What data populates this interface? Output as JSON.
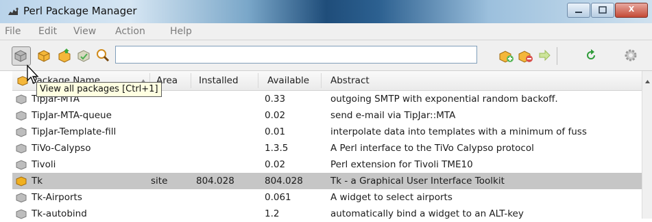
{
  "window": {
    "title": "Perl Package Manager",
    "controls": [
      "minimize",
      "maximize",
      "close"
    ],
    "close_glyph": "X"
  },
  "menu": [
    "File",
    "Edit",
    "View",
    "Action",
    "Help"
  ],
  "toolbar": {
    "left_buttons": [
      "view-all-packages-icon",
      "view-installed-packages-icon",
      "view-upgradable-packages-icon",
      "view-packages-to-install-remove-icon",
      "search-icon"
    ],
    "search": {
      "value": "",
      "placeholder": ""
    },
    "right_buttons": [
      "mark-install-icon",
      "mark-remove-icon",
      "run-marked-actions-icon",
      "refresh-icon",
      "preferences-icon"
    ]
  },
  "table": {
    "columns": [
      "Package Name",
      "Area",
      "Installed",
      "Available",
      "Abstract"
    ],
    "rows": [
      {
        "name": "TipJar-MTA",
        "area": "",
        "installed": "",
        "available": "0.33",
        "abstract": "outgoing SMTP with exponential random backoff."
      },
      {
        "name": "TipJar-MTA-queue",
        "area": "",
        "installed": "",
        "available": "0.02",
        "abstract": "send e-mail via TipJar::MTA"
      },
      {
        "name": "TipJar-Template-fill",
        "area": "",
        "installed": "",
        "available": "0.01",
        "abstract": "interpolate data into templates with a minimum of fuss"
      },
      {
        "name": "TiVo-Calypso",
        "area": "",
        "installed": "",
        "available": "1.3.5",
        "abstract": "A Perl interface to the TiVo Calypso protocol"
      },
      {
        "name": "Tivoli",
        "area": "",
        "installed": "",
        "available": "0.02",
        "abstract": "Perl extension for Tivoli TME10"
      },
      {
        "name": "Tk",
        "area": "site",
        "installed": "804.028",
        "available": "804.028",
        "abstract": "Tk - a Graphical User Interface Toolkit"
      },
      {
        "name": "Tk-Airports",
        "area": "",
        "installed": "",
        "available": "0.061",
        "abstract": "A widget to select airports"
      },
      {
        "name": "Tk-autobind",
        "area": "",
        "installed": "",
        "available": "1.2",
        "abstract": "automatically bind a widget to an ALT-key"
      }
    ]
  },
  "tooltip": "View all packages [Ctrl+1]",
  "colors": {
    "selected_row": "#c6c6c6",
    "package_icon": "#9a9a9a",
    "installed_package_icon": "#f0b020",
    "tooltip_bg": "#ffffe1"
  }
}
